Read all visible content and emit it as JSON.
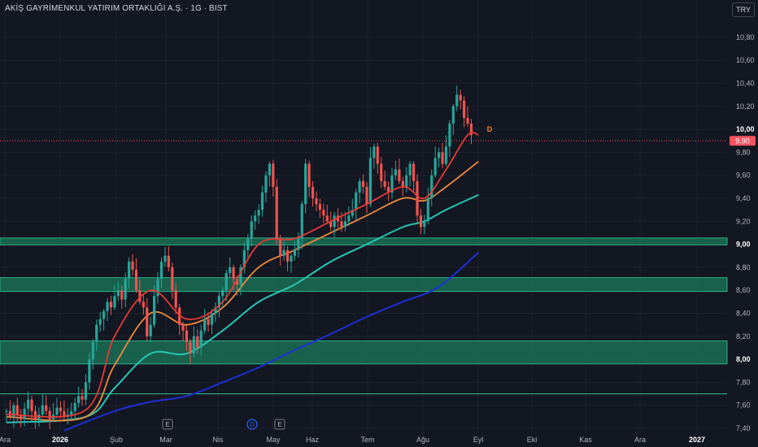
{
  "header": {
    "title": "AKİŞ GAYRİMENKUL YATIRIM ORTAKLIĞI A.Ş. · 1G · BIST",
    "currency": "TRY"
  },
  "colors": {
    "background": "#131722",
    "grid": "#1e222d",
    "up": "#26a69a",
    "down": "#ef5350",
    "ema_fast": "#e53935",
    "ema_mid": "#ef8a3c",
    "ema_slow": "#26c6b4",
    "ema_long": "#1e2fd6",
    "zone_fill": "#1b6e55",
    "price_label": "#f7525f"
  },
  "chart_data": {
    "type": "candlestick",
    "y_ticks": [
      "7,40",
      "7,60",
      "7,80",
      "8,00",
      "8,20",
      "8,40",
      "8,60",
      "8,80",
      "9,00",
      "9,20",
      "9,40",
      "9,60",
      "9,80",
      "10,00",
      "10,20",
      "10,40",
      "10,60",
      "10,80"
    ],
    "y_bold_ticks": [
      "8,00",
      "9,00",
      "10,00"
    ],
    "ylim": [
      7.38,
      10.95
    ],
    "x_ticks": [
      "Ara",
      "2026",
      "Şub",
      "Mar",
      "Nis",
      "May",
      "Haz",
      "Tem",
      "Ağu",
      "Eyl",
      "Eki",
      "Kas",
      "Ara",
      "2027"
    ],
    "x_bold_ticks": [
      "2026",
      "2027"
    ],
    "last_price": "9,90",
    "last_price_value": 9.9,
    "support_resistance_zones": [
      [
        8.995,
        9.055
      ],
      [
        8.59,
        8.71
      ],
      [
        7.96,
        8.16
      ]
    ],
    "support_line": 7.7,
    "markers": [
      {
        "label": "E",
        "kind": "earnings",
        "month": "Mar"
      },
      {
        "label": "D",
        "kind": "dividend",
        "month": "May"
      },
      {
        "label": "E",
        "kind": "earnings",
        "month": "May"
      },
      {
        "label": "D",
        "kind": "dividend-flag",
        "month": "Eyl"
      }
    ],
    "candles_close": [
      7.55,
      7.5,
      7.6,
      7.52,
      7.48,
      7.57,
      7.65,
      7.55,
      7.47,
      7.52,
      7.6,
      7.55,
      7.48,
      7.52,
      7.58,
      7.55,
      7.5,
      7.52,
      7.55,
      7.62,
      7.68,
      7.65,
      7.8,
      8.0,
      8.15,
      8.3,
      8.35,
      8.42,
      8.5,
      8.45,
      8.55,
      8.6,
      8.52,
      8.7,
      8.85,
      8.78,
      8.6,
      8.5,
      8.45,
      8.2,
      8.3,
      8.55,
      8.7,
      8.85,
      8.9,
      8.8,
      8.6,
      8.45,
      8.3,
      8.25,
      8.15,
      8.05,
      8.2,
      8.1,
      8.25,
      8.35,
      8.3,
      8.4,
      8.45,
      8.55,
      8.6,
      8.75,
      8.8,
      8.7,
      8.65,
      8.8,
      8.95,
      9.05,
      9.2,
      9.25,
      9.3,
      9.45,
      9.6,
      9.7,
      9.5,
      9.05,
      8.9,
      8.95,
      8.85,
      8.9,
      8.95,
      9.05,
      9.35,
      9.7,
      9.5,
      9.4,
      9.35,
      9.3,
      9.25,
      9.2,
      9.15,
      9.25,
      9.2,
      9.15,
      9.2,
      9.25,
      9.3,
      9.45,
      9.55,
      9.5,
      9.35,
      9.75,
      9.85,
      9.7,
      9.55,
      9.5,
      9.45,
      9.6,
      9.65,
      9.55,
      9.5,
      9.6,
      9.7,
      9.55,
      9.25,
      9.15,
      9.2,
      9.4,
      9.6,
      9.75,
      9.8,
      9.7,
      9.85,
      10.05,
      10.2,
      10.3,
      10.25,
      10.1,
      10.05,
      9.95
    ],
    "ema_fast_anchors": [
      [
        0,
        7.52
      ],
      [
        22,
        7.56
      ],
      [
        30,
        8.2
      ],
      [
        40,
        8.6
      ],
      [
        50,
        8.35
      ],
      [
        60,
        8.5
      ],
      [
        70,
        9.0
      ],
      [
        80,
        9.05
      ],
      [
        90,
        9.2
      ],
      [
        100,
        9.35
      ],
      [
        110,
        9.5
      ],
      [
        116,
        9.4
      ],
      [
        122,
        9.65
      ],
      [
        128,
        9.95
      ],
      [
        131,
        9.95
      ]
    ],
    "ema_mid_anchors": [
      [
        0,
        7.5
      ],
      [
        22,
        7.5
      ],
      [
        30,
        7.95
      ],
      [
        40,
        8.4
      ],
      [
        50,
        8.3
      ],
      [
        60,
        8.45
      ],
      [
        70,
        8.8
      ],
      [
        80,
        8.95
      ],
      [
        90,
        9.1
      ],
      [
        100,
        9.25
      ],
      [
        110,
        9.4
      ],
      [
        116,
        9.38
      ],
      [
        122,
        9.5
      ],
      [
        131,
        9.72
      ]
    ],
    "ema_slow_anchors": [
      [
        0,
        7.45
      ],
      [
        22,
        7.5
      ],
      [
        30,
        7.75
      ],
      [
        40,
        8.05
      ],
      [
        50,
        8.05
      ],
      [
        60,
        8.25
      ],
      [
        70,
        8.5
      ],
      [
        80,
        8.65
      ],
      [
        90,
        8.85
      ],
      [
        100,
        9.0
      ],
      [
        110,
        9.15
      ],
      [
        116,
        9.2
      ],
      [
        122,
        9.3
      ],
      [
        131,
        9.43
      ]
    ],
    "ema_long_anchors": [
      [
        16,
        7.38
      ],
      [
        30,
        7.55
      ],
      [
        40,
        7.63
      ],
      [
        50,
        7.68
      ],
      [
        60,
        7.8
      ],
      [
        70,
        7.93
      ],
      [
        80,
        8.08
      ],
      [
        90,
        8.22
      ],
      [
        100,
        8.37
      ],
      [
        110,
        8.5
      ],
      [
        120,
        8.63
      ],
      [
        131,
        8.93
      ]
    ]
  }
}
